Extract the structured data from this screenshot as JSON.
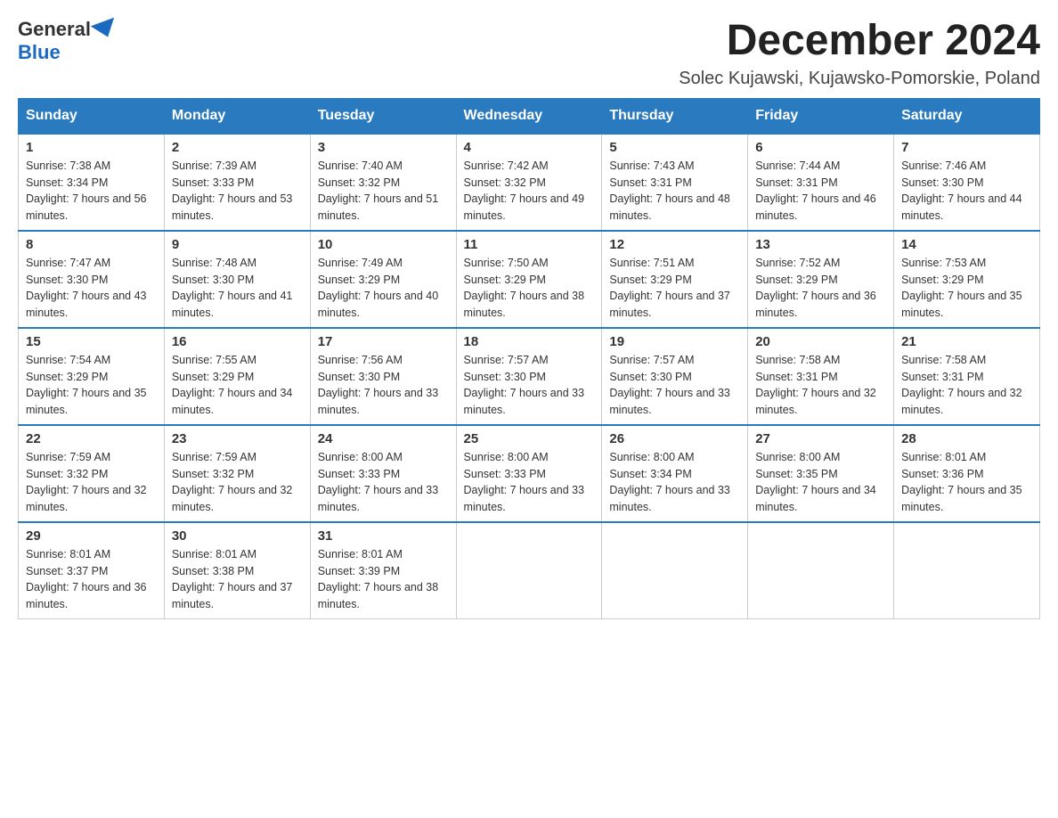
{
  "logo": {
    "general": "General",
    "blue": "Blue"
  },
  "title": "December 2024",
  "subtitle": "Solec Kujawski, Kujawsko-Pomorskie, Poland",
  "days_of_week": [
    "Sunday",
    "Monday",
    "Tuesday",
    "Wednesday",
    "Thursday",
    "Friday",
    "Saturday"
  ],
  "weeks": [
    [
      {
        "day": "1",
        "sunrise": "7:38 AM",
        "sunset": "3:34 PM",
        "daylight": "7 hours and 56 minutes."
      },
      {
        "day": "2",
        "sunrise": "7:39 AM",
        "sunset": "3:33 PM",
        "daylight": "7 hours and 53 minutes."
      },
      {
        "day": "3",
        "sunrise": "7:40 AM",
        "sunset": "3:32 PM",
        "daylight": "7 hours and 51 minutes."
      },
      {
        "day": "4",
        "sunrise": "7:42 AM",
        "sunset": "3:32 PM",
        "daylight": "7 hours and 49 minutes."
      },
      {
        "day": "5",
        "sunrise": "7:43 AM",
        "sunset": "3:31 PM",
        "daylight": "7 hours and 48 minutes."
      },
      {
        "day": "6",
        "sunrise": "7:44 AM",
        "sunset": "3:31 PM",
        "daylight": "7 hours and 46 minutes."
      },
      {
        "day": "7",
        "sunrise": "7:46 AM",
        "sunset": "3:30 PM",
        "daylight": "7 hours and 44 minutes."
      }
    ],
    [
      {
        "day": "8",
        "sunrise": "7:47 AM",
        "sunset": "3:30 PM",
        "daylight": "7 hours and 43 minutes."
      },
      {
        "day": "9",
        "sunrise": "7:48 AM",
        "sunset": "3:30 PM",
        "daylight": "7 hours and 41 minutes."
      },
      {
        "day": "10",
        "sunrise": "7:49 AM",
        "sunset": "3:29 PM",
        "daylight": "7 hours and 40 minutes."
      },
      {
        "day": "11",
        "sunrise": "7:50 AM",
        "sunset": "3:29 PM",
        "daylight": "7 hours and 38 minutes."
      },
      {
        "day": "12",
        "sunrise": "7:51 AM",
        "sunset": "3:29 PM",
        "daylight": "7 hours and 37 minutes."
      },
      {
        "day": "13",
        "sunrise": "7:52 AM",
        "sunset": "3:29 PM",
        "daylight": "7 hours and 36 minutes."
      },
      {
        "day": "14",
        "sunrise": "7:53 AM",
        "sunset": "3:29 PM",
        "daylight": "7 hours and 35 minutes."
      }
    ],
    [
      {
        "day": "15",
        "sunrise": "7:54 AM",
        "sunset": "3:29 PM",
        "daylight": "7 hours and 35 minutes."
      },
      {
        "day": "16",
        "sunrise": "7:55 AM",
        "sunset": "3:29 PM",
        "daylight": "7 hours and 34 minutes."
      },
      {
        "day": "17",
        "sunrise": "7:56 AM",
        "sunset": "3:30 PM",
        "daylight": "7 hours and 33 minutes."
      },
      {
        "day": "18",
        "sunrise": "7:57 AM",
        "sunset": "3:30 PM",
        "daylight": "7 hours and 33 minutes."
      },
      {
        "day": "19",
        "sunrise": "7:57 AM",
        "sunset": "3:30 PM",
        "daylight": "7 hours and 33 minutes."
      },
      {
        "day": "20",
        "sunrise": "7:58 AM",
        "sunset": "3:31 PM",
        "daylight": "7 hours and 32 minutes."
      },
      {
        "day": "21",
        "sunrise": "7:58 AM",
        "sunset": "3:31 PM",
        "daylight": "7 hours and 32 minutes."
      }
    ],
    [
      {
        "day": "22",
        "sunrise": "7:59 AM",
        "sunset": "3:32 PM",
        "daylight": "7 hours and 32 minutes."
      },
      {
        "day": "23",
        "sunrise": "7:59 AM",
        "sunset": "3:32 PM",
        "daylight": "7 hours and 32 minutes."
      },
      {
        "day": "24",
        "sunrise": "8:00 AM",
        "sunset": "3:33 PM",
        "daylight": "7 hours and 33 minutes."
      },
      {
        "day": "25",
        "sunrise": "8:00 AM",
        "sunset": "3:33 PM",
        "daylight": "7 hours and 33 minutes."
      },
      {
        "day": "26",
        "sunrise": "8:00 AM",
        "sunset": "3:34 PM",
        "daylight": "7 hours and 33 minutes."
      },
      {
        "day": "27",
        "sunrise": "8:00 AM",
        "sunset": "3:35 PM",
        "daylight": "7 hours and 34 minutes."
      },
      {
        "day": "28",
        "sunrise": "8:01 AM",
        "sunset": "3:36 PM",
        "daylight": "7 hours and 35 minutes."
      }
    ],
    [
      {
        "day": "29",
        "sunrise": "8:01 AM",
        "sunset": "3:37 PM",
        "daylight": "7 hours and 36 minutes."
      },
      {
        "day": "30",
        "sunrise": "8:01 AM",
        "sunset": "3:38 PM",
        "daylight": "7 hours and 37 minutes."
      },
      {
        "day": "31",
        "sunrise": "8:01 AM",
        "sunset": "3:39 PM",
        "daylight": "7 hours and 38 minutes."
      },
      null,
      null,
      null,
      null
    ]
  ]
}
